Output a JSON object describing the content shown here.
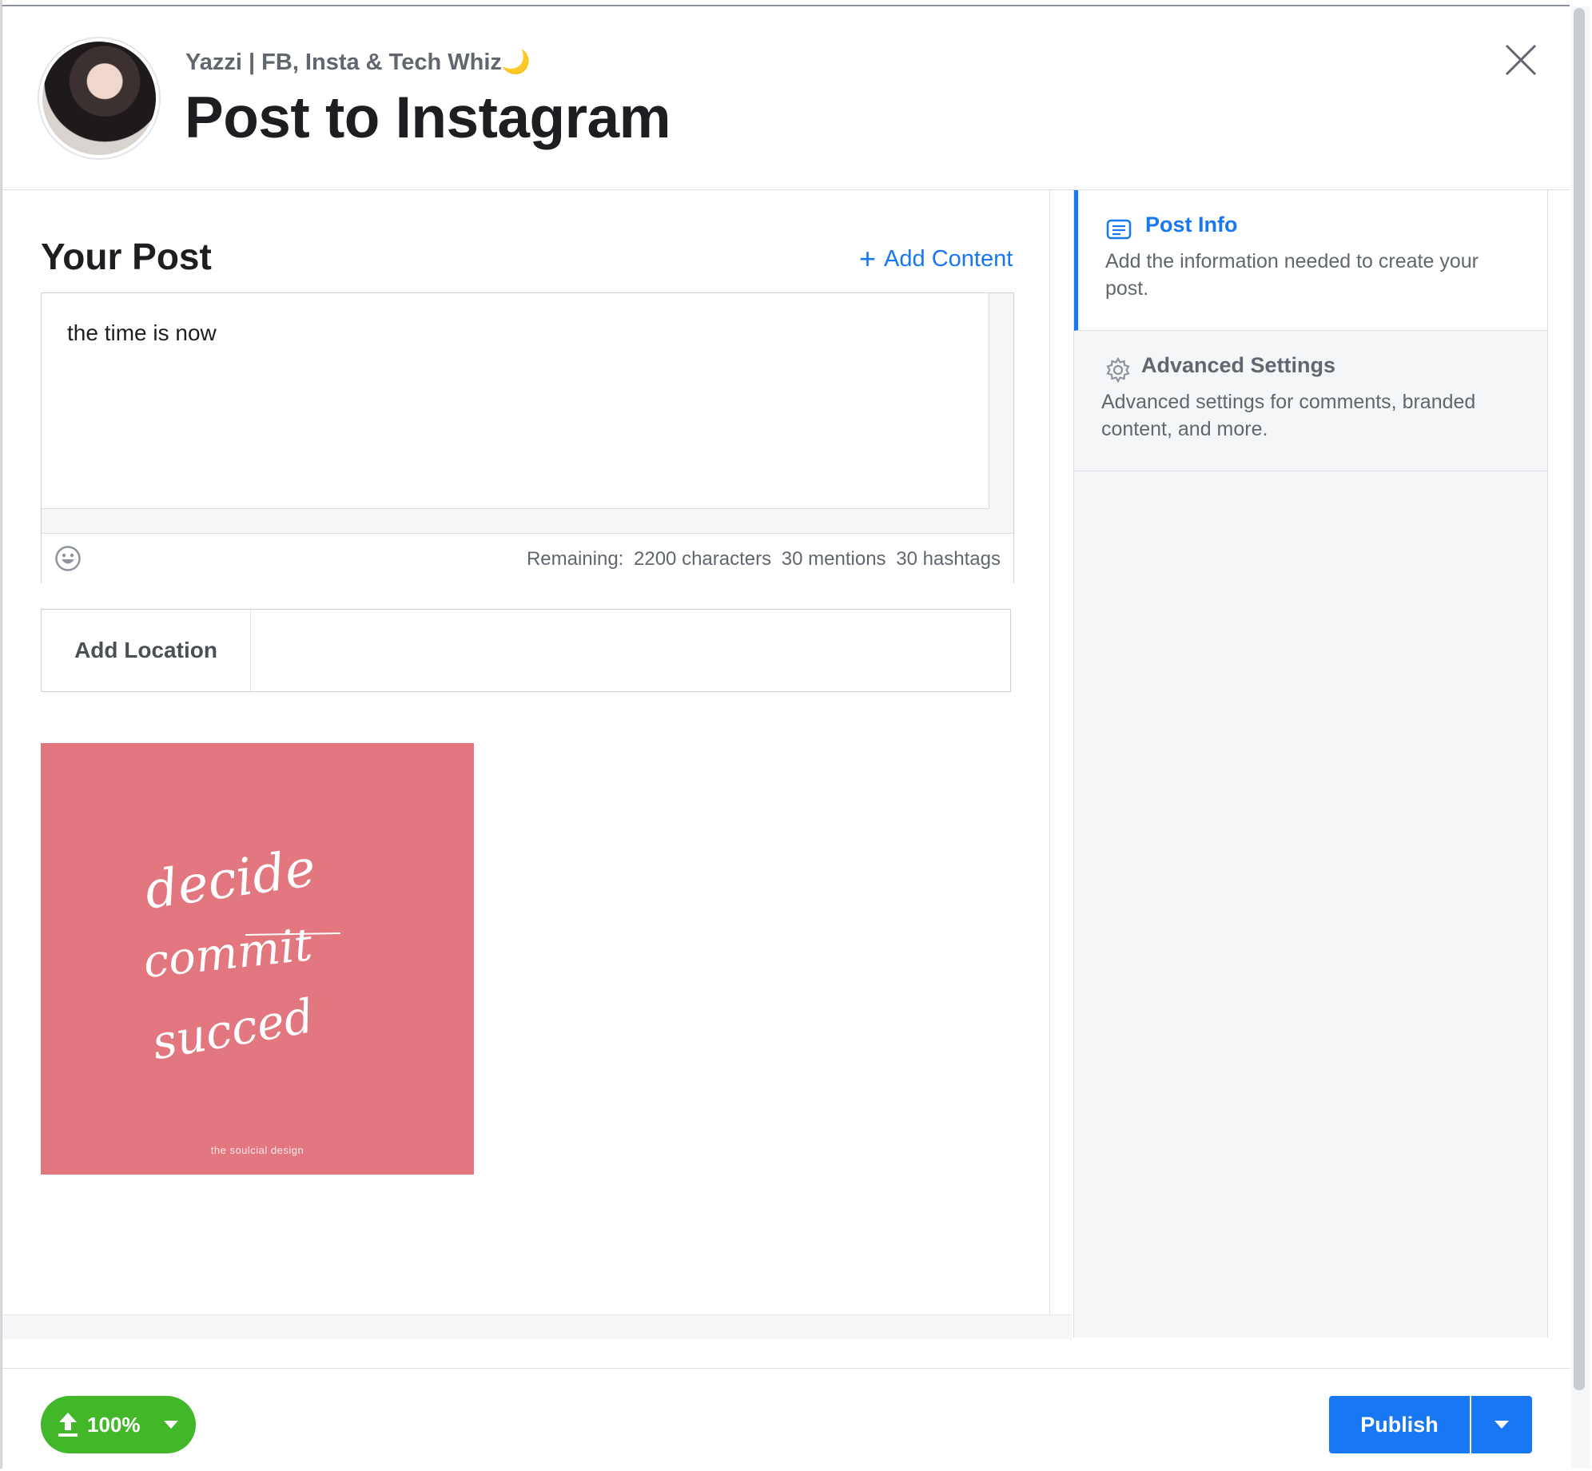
{
  "header": {
    "page_name": "Yazzi | FB, Insta & Tech Whiz🌙",
    "title": "Post to Instagram",
    "close_icon": "close-icon"
  },
  "post": {
    "section_title": "Your Post",
    "add_content_label": "Add Content",
    "caption_text": "the time is now",
    "remaining_label": "Remaining:",
    "remaining_characters": "2200 characters",
    "remaining_mentions": "30 mentions",
    "remaining_hashtags": "30 hashtags",
    "emoji_icon": "emoji-icon"
  },
  "location": {
    "label": "Add Location",
    "value": ""
  },
  "media": {
    "lines": [
      "decide",
      "commit",
      "succed"
    ],
    "caption": "the soulcial design",
    "background": "#e37780"
  },
  "sidebar": {
    "steps": [
      {
        "icon": "list-icon",
        "title": "Post Info",
        "description": "Add the information needed to create your post.",
        "active": true
      },
      {
        "icon": "gear-icon",
        "title": "Advanced Settings",
        "description": "Advanced settings for comments, branded content, and more.",
        "active": false
      }
    ]
  },
  "footer": {
    "upload_percent": "100%",
    "publish_label": "Publish"
  },
  "colors": {
    "accent": "#1877f2",
    "upload_green": "#42b72a",
    "text_primary": "#1c1e21",
    "text_secondary": "#606770"
  }
}
